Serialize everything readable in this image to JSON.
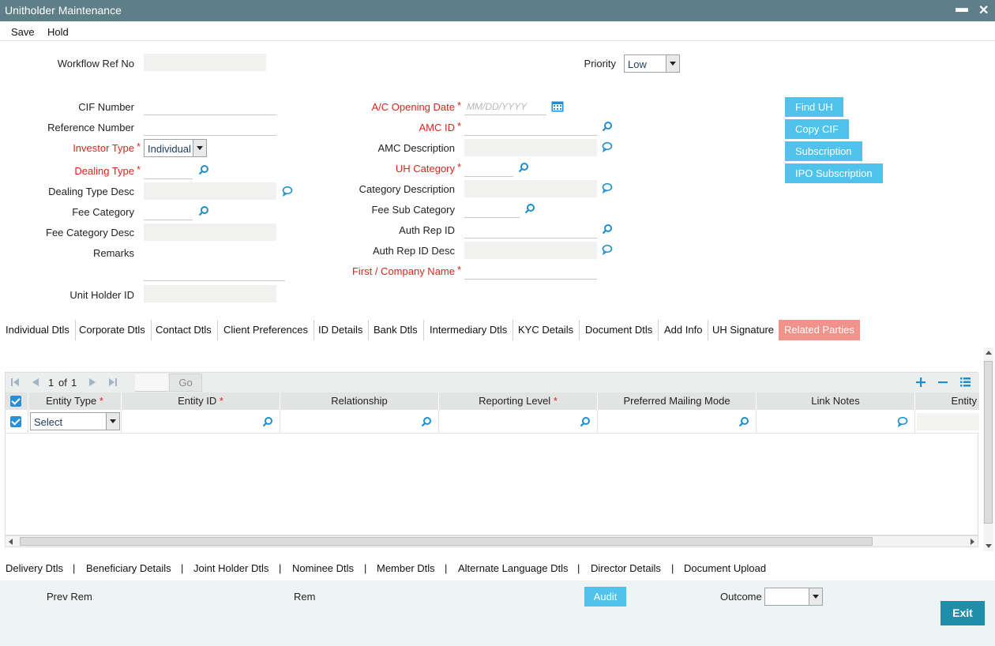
{
  "window": {
    "title": "Unitholder Maintenance",
    "minimize": "▬",
    "close": "✕"
  },
  "menu": {
    "save": "Save",
    "hold": "Hold"
  },
  "form": {
    "workflow_ref_no": {
      "label": "Workflow Ref No",
      "value": ""
    },
    "priority": {
      "label": "Priority",
      "value": "Low"
    },
    "cif_number": {
      "label": "CIF Number",
      "value": ""
    },
    "reference_number": {
      "label": "Reference Number",
      "value": ""
    },
    "investor_type": {
      "label": "Investor Type",
      "value": "Individual"
    },
    "dealing_type": {
      "label": "Dealing Type",
      "value": ""
    },
    "dealing_type_desc": {
      "label": "Dealing Type Desc",
      "value": ""
    },
    "fee_category": {
      "label": "Fee Category",
      "value": ""
    },
    "fee_category_desc": {
      "label": "Fee Category Desc",
      "value": ""
    },
    "remarks": {
      "label": "Remarks",
      "value": ""
    },
    "unit_holder_id": {
      "label": "Unit Holder ID",
      "value": ""
    },
    "ac_opening_date": {
      "label": "A/C Opening Date",
      "placeholder": "MM/DD/YYYY"
    },
    "amc_id": {
      "label": "AMC ID",
      "value": ""
    },
    "amc_description": {
      "label": "AMC Description",
      "value": ""
    },
    "uh_category": {
      "label": "UH Category",
      "value": ""
    },
    "category_description": {
      "label": "Category Description",
      "value": ""
    },
    "fee_sub_category": {
      "label": "Fee Sub Category",
      "value": ""
    },
    "auth_rep_id": {
      "label": "Auth Rep ID",
      "value": ""
    },
    "auth_rep_id_desc": {
      "label": "Auth Rep ID Desc",
      "value": ""
    },
    "first_company_name": {
      "label": "First / Company Name",
      "value": ""
    },
    "required_mark": "*"
  },
  "side_buttons": {
    "find_uh": "Find UH",
    "copy_cif": "Copy CIF",
    "subscription": "Subscription",
    "ipo_subscription": "IPO Subscription"
  },
  "tabs": [
    "Individual Dtls",
    "Corporate Dtls",
    "Contact Dtls",
    "Client Preferences",
    "ID Details",
    "Bank Dtls",
    "Intermediary Dtls",
    "KYC Details",
    "Document Dtls",
    "Add Info",
    "UH Signature",
    "Related Parties"
  ],
  "grid": {
    "pager": {
      "page": "1",
      "of_label": "of",
      "total": "1",
      "go": "Go"
    },
    "columns": [
      "Entity Type",
      "Entity ID",
      "Relationship",
      "Reporting Level",
      "Preferred Mailing Mode",
      "Link Notes",
      "Entity"
    ],
    "required_mark": "*",
    "row": {
      "entity_type": "Select"
    }
  },
  "bottom_links": [
    "Delivery Dtls",
    "Beneficiary Details",
    "Joint Holder Dtls",
    "Nominee Dtls",
    "Member Dtls",
    "Alternate Language Dtls",
    "Director Details",
    "Document Upload"
  ],
  "link_separator": "|",
  "footer": {
    "prev_rem": "Prev Rem",
    "rem": "Rem",
    "audit": "Audit",
    "outcome": "Outcome",
    "outcome_value": "",
    "exit": "Exit"
  },
  "colors": {
    "titlebar": "#5e7f87",
    "accent_blue": "#4fc3ec",
    "active_tab": "#f2938b",
    "required_red": "#d9251b",
    "exit_button": "#1f8ea8"
  },
  "icons": {
    "search": "search-icon",
    "comment": "comment-icon",
    "calendar": "calendar-icon"
  }
}
